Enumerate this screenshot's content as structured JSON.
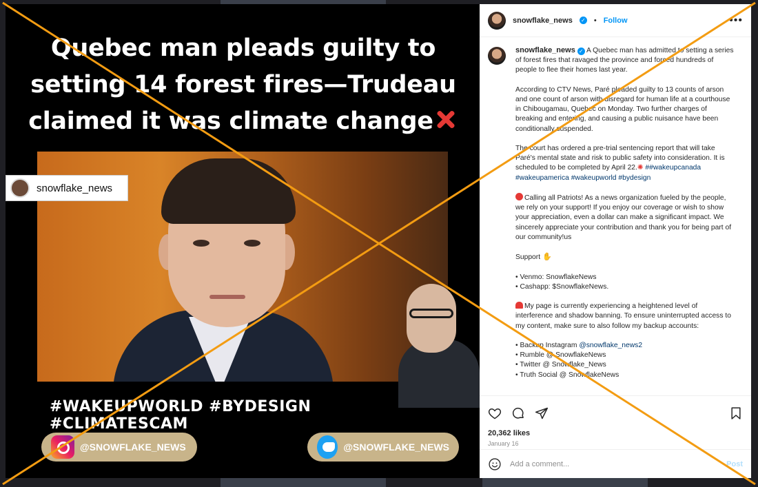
{
  "post_image": {
    "headline": "Quebec man pleads guilty to setting 14 forest fires—Trudeau claimed it was climate change",
    "tag_username": "snowflake_news",
    "hashtags": "#WAKEUPWORLD #BYDESIGN #CLIMATESCAM",
    "instagram_handle": "@SNOWFLAKE_NEWS",
    "twitter_handle": "@SNOWFLAKE_NEWS"
  },
  "header": {
    "username": "snowflake_news",
    "separator": "•",
    "follow_label": "Follow",
    "more_label": "•••"
  },
  "caption": {
    "username": "snowflake_news",
    "p1": "A Quebec man has admitted to setting a series of forest fires that ravaged the province and forced hundreds of people to flee their homes last year.",
    "p2": "According to CTV News, Paré pleaded guilty to 13 counts of arson and one count of arson with disregard for human life at a courthouse in Chibougamau, Quebec on Monday. Two further charges of breaking and entering, and causing a public nuisance have been conditionally suspended.",
    "p3_text": "The court has ordered a pre-trial sentencing report that will take Paré's mental state and risk to public safety into consideration. It is scheduled to be completed by April 22.",
    "p3_tags": "##wakeupcanada #wakeupamerica #wakeupworld #bydesign",
    "p4": "Calling all Patriots! As a news organization fueled by the people, we rely on your support! If you enjoy our coverage or wish to show your appreciation, even a dollar can make a significant impact. We sincerely appreciate your contribution and thank you for being part of our community!us",
    "support_label": "Support",
    "venmo": "• Venmo: SnowflakeNews",
    "cashapp": "• Cashapp: $SnowflakeNews.",
    "p6": "My page is currently experiencing a heightened level of interference and shadow banning. To ensure uninterrupted access to my content, make sure to also follow my backup accounts:",
    "backup_ig_prefix": "• Backup Instagram ",
    "backup_ig_link": "@snowflake_news2",
    "rumble": "• Rumble @ SnowflakeNews",
    "twitter": "• Twitter @ Snowflake_News",
    "truth": "• Truth Social @ SnowflakeNews"
  },
  "engagement": {
    "likes": "20,362 likes",
    "date": "January 16"
  },
  "comment": {
    "placeholder": "Add a comment...",
    "post_label": "Post"
  },
  "icons": [
    "heart-icon",
    "comment-icon",
    "share-icon",
    "bookmark-icon",
    "emoji-icon",
    "verified-icon",
    "more-icon"
  ],
  "colors": {
    "overlay_x": "#f39c12",
    "accent": "#0095f6"
  }
}
